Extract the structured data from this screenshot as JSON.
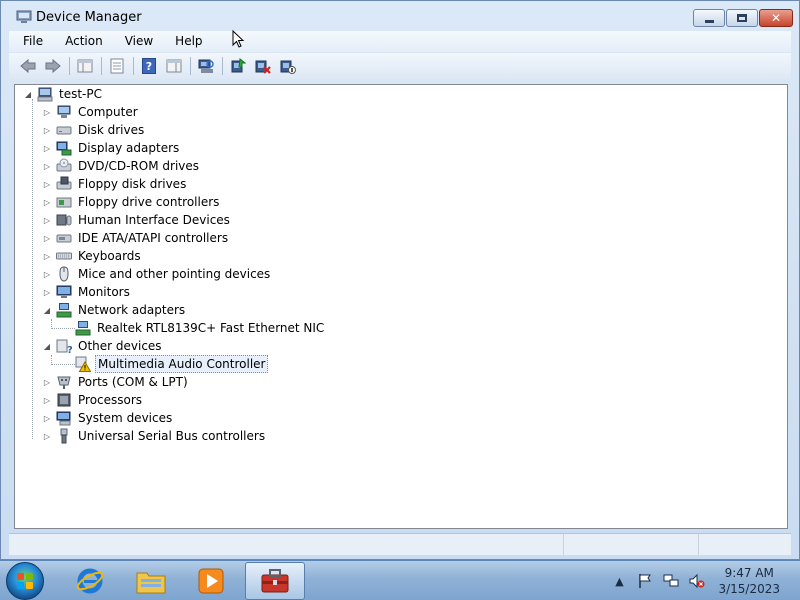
{
  "window": {
    "title": "Device Manager",
    "minimize_icon": "minimize-icon",
    "maximize_icon": "maximize-icon",
    "close_icon": "close-icon"
  },
  "menu": [
    "File",
    "Action",
    "View",
    "Help"
  ],
  "toolbar": [
    {
      "name": "back-icon"
    },
    {
      "name": "forward-icon"
    },
    {
      "name": "show-hide-console-tree-icon"
    },
    {
      "name": "properties-icon"
    },
    {
      "name": "help-icon"
    },
    {
      "name": "show-action-pane-icon"
    },
    {
      "name": "scan-hardware-changes-icon"
    },
    {
      "name": "update-driver-icon"
    },
    {
      "name": "uninstall-icon"
    },
    {
      "name": "disable-device-icon"
    }
  ],
  "tree": {
    "root": "test-PC",
    "categories": [
      {
        "label": "Computer",
        "icon": "computer-icon",
        "expanded": false
      },
      {
        "label": "Disk drives",
        "icon": "disk-drive-icon",
        "expanded": false
      },
      {
        "label": "Display adapters",
        "icon": "display-adapter-icon",
        "expanded": false
      },
      {
        "label": "DVD/CD-ROM drives",
        "icon": "dvd-drive-icon",
        "expanded": false
      },
      {
        "label": "Floppy disk drives",
        "icon": "floppy-disk-icon",
        "expanded": false
      },
      {
        "label": "Floppy drive controllers",
        "icon": "floppy-controller-icon",
        "expanded": false
      },
      {
        "label": "Human Interface Devices",
        "icon": "hid-icon",
        "expanded": false
      },
      {
        "label": "IDE ATA/ATAPI controllers",
        "icon": "ide-controller-icon",
        "expanded": false
      },
      {
        "label": "Keyboards",
        "icon": "keyboard-icon",
        "expanded": false
      },
      {
        "label": "Mice and other pointing devices",
        "icon": "mouse-icon",
        "expanded": false
      },
      {
        "label": "Monitors",
        "icon": "monitor-icon",
        "expanded": false
      },
      {
        "label": "Network adapters",
        "icon": "network-adapter-icon",
        "expanded": true,
        "children": [
          {
            "label": "Realtek RTL8139C+ Fast Ethernet NIC",
            "icon": "network-card-icon"
          }
        ]
      },
      {
        "label": "Other devices",
        "icon": "other-devices-icon",
        "expanded": true,
        "children": [
          {
            "label": "Multimedia Audio Controller",
            "icon": "warning-device-icon",
            "selected": true
          }
        ]
      },
      {
        "label": "Ports (COM & LPT)",
        "icon": "port-icon",
        "expanded": false
      },
      {
        "label": "Processors",
        "icon": "processor-icon",
        "expanded": false
      },
      {
        "label": "System devices",
        "icon": "system-device-icon",
        "expanded": false
      },
      {
        "label": "Universal Serial Bus controllers",
        "icon": "usb-icon",
        "expanded": false
      }
    ]
  },
  "taskbar": {
    "apps": [
      {
        "name": "internet-explorer-icon",
        "active": false
      },
      {
        "name": "windows-explorer-icon",
        "active": false
      },
      {
        "name": "media-player-icon",
        "active": false
      },
      {
        "name": "device-manager-taskbar-icon",
        "active": true
      }
    ],
    "clock_time": "9:47 AM",
    "clock_date": "3/15/2023"
  },
  "colors": {
    "selection": "#e8f0fb",
    "taskbar": "#8fb1d6",
    "warning": "#f2c200"
  }
}
